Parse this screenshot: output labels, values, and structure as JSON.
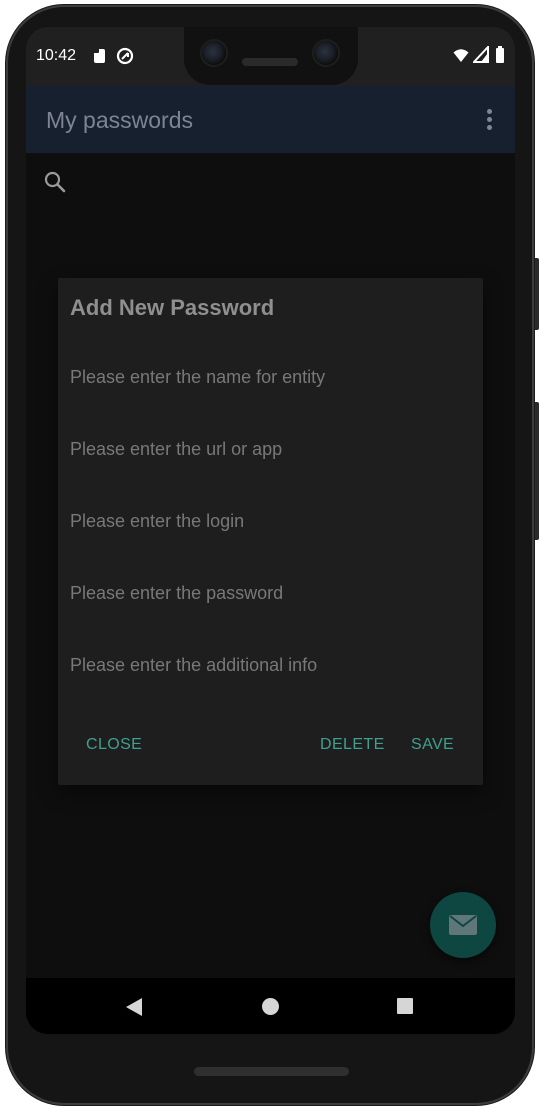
{
  "status_bar": {
    "time": "10:42",
    "left_icons": [
      "sd-card-icon",
      "sync-icon"
    ],
    "right_icons": [
      "wifi-icon",
      "signal-icon",
      "battery-icon"
    ]
  },
  "app_bar": {
    "title": "My passwords",
    "menu_icon": "overflow-menu-icon"
  },
  "search": {
    "icon": "search-icon"
  },
  "dialog": {
    "title": "Add New Password",
    "fields": [
      {
        "placeholder": "Please enter the name for entity",
        "value": ""
      },
      {
        "placeholder": "Please enter the url or app",
        "value": ""
      },
      {
        "placeholder": "Please enter the login",
        "value": ""
      },
      {
        "placeholder": "Please enter the password",
        "value": ""
      },
      {
        "placeholder": "Please enter the additional info",
        "value": ""
      }
    ],
    "buttons": {
      "close": "CLOSE",
      "delete": "DELETE",
      "save": "SAVE"
    }
  },
  "fab": {
    "icon": "mail-icon"
  },
  "nav_bar": {
    "icons": [
      "back-icon",
      "home-icon",
      "recents-icon"
    ]
  },
  "colors": {
    "app_bar": "#16202e",
    "accent": "#3fa08d",
    "fab": "#0e4641",
    "dialog_bg": "#1e1e1e"
  }
}
